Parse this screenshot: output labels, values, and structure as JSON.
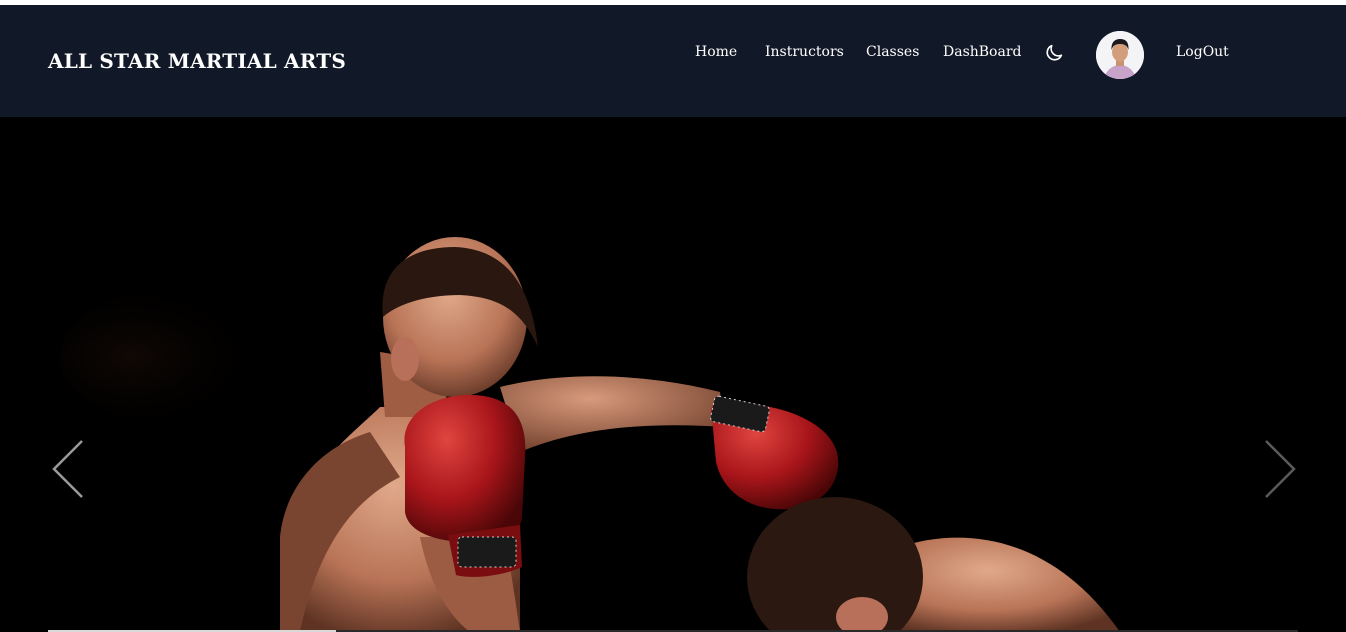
{
  "brand": {
    "title": "ALL STAR MARTIAL ARTS"
  },
  "nav": {
    "items": [
      {
        "label": "Home"
      },
      {
        "label": "Instructors"
      },
      {
        "label": "Classes"
      },
      {
        "label": "DashBoard"
      }
    ],
    "theme_icon": "moon-icon",
    "avatar_icon": "user-avatar",
    "logout_label": "LogOut"
  },
  "hero": {
    "image": "boxing-sparring-photo",
    "prev_icon": "chevron-left-icon",
    "next_icon": "chevron-right-icon",
    "progress": 0.23
  },
  "colors": {
    "navbar_bg": "#111827",
    "hero_bg": "#000000",
    "glove_red": "#b3171b",
    "text": "#ffffff"
  }
}
